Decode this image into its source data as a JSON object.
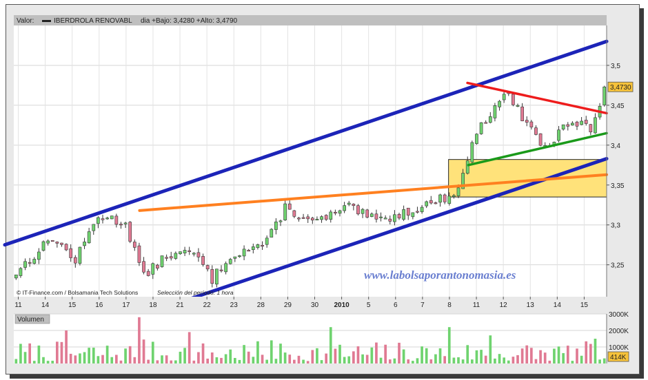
{
  "header": {
    "valor_label": "Valor:",
    "instrument": "IBERDROLA RENOVABL",
    "stats": "dia +Bajo: 3,4280 +Alto: 3,4790"
  },
  "credit": "© IT-Finance.com / Bolsamania Tech Solutions",
  "period": "Selección del período: 1 hora",
  "watermark": "www.labolsaporantonomasia.es",
  "last_price_label": "3,4730",
  "volume_label": "Volumen",
  "volume_last_label": "414K",
  "colors": {
    "up_candle": "#6fd36f",
    "down_candle": "#e07a93",
    "channel": "#1c24b8",
    "orange_line": "#ff8020",
    "red_line": "#ee1c1c",
    "green_line": "#1a9a1a",
    "zone_fill": "#ffe27a",
    "price_badge": "#f6c23a"
  },
  "chart_data": [
    {
      "type": "candlestick",
      "title": "IBERDROLA RENOVABL",
      "y_ticks": [
        "3,25",
        "3,3",
        "3,35",
        "3,4",
        "3,45",
        "3,5"
      ],
      "y_tick_values": [
        3.25,
        3.3,
        3.35,
        3.4,
        3.45,
        3.5
      ],
      "ylim": [
        3.21,
        3.55
      ],
      "x_tick_labels": [
        "11",
        "14",
        "15",
        "16",
        "17",
        "18",
        "21",
        "22",
        "23",
        "28",
        "29",
        "30",
        "2010",
        "5",
        "6",
        "7",
        "8",
        "11",
        "12",
        "13",
        "14",
        "15"
      ],
      "x_tick_positions": [
        0.5,
        3.5,
        6.5,
        9.5,
        12.5,
        15.5,
        18.5,
        21.5,
        24.5,
        27.5,
        30.5,
        33.5,
        36.5,
        39.5,
        42.5,
        45.5,
        48.5,
        51.5,
        54.5,
        57.5,
        60.5,
        63.5
      ],
      "x_domain": [
        0,
        66
      ],
      "n_bars": 130,
      "price_anchors": [
        [
          0,
          3.235
        ],
        [
          6,
          3.268
        ],
        [
          9,
          3.285
        ],
        [
          14,
          3.255
        ],
        [
          19,
          3.312
        ],
        [
          25,
          3.302
        ],
        [
          29,
          3.235
        ],
        [
          34,
          3.262
        ],
        [
          40,
          3.265
        ],
        [
          44,
          3.232
        ],
        [
          48,
          3.262
        ],
        [
          56,
          3.278
        ],
        [
          60,
          3.322
        ],
        [
          66,
          3.302
        ],
        [
          74,
          3.322
        ],
        [
          80,
          3.305
        ],
        [
          86,
          3.315
        ],
        [
          94,
          3.332
        ],
        [
          98,
          3.343
        ],
        [
          101,
          3.405
        ],
        [
          104,
          3.432
        ],
        [
          108,
          3.468
        ],
        [
          110,
          3.452
        ],
        [
          114,
          3.42
        ],
        [
          117,
          3.395
        ],
        [
          121,
          3.42
        ],
        [
          124,
          3.428
        ],
        [
          127,
          3.42
        ],
        [
          129,
          3.45
        ],
        [
          130,
          3.473
        ]
      ],
      "last_price": 3.473,
      "lines": [
        {
          "name": "channel-upper",
          "color": "#1c24b8",
          "from": [
            -1,
            3.275
          ],
          "to": [
            66,
            3.53
          ]
        },
        {
          "name": "channel-lower",
          "color": "#1c24b8",
          "from": [
            19.8,
            3.208
          ],
          "to": [
            66,
            3.383
          ]
        },
        {
          "name": "orange-trend",
          "color": "#ff8020",
          "from": [
            14,
            3.318
          ],
          "to": [
            66,
            3.363
          ]
        },
        {
          "name": "red-trend",
          "color": "#ee1c1c",
          "from": [
            50.5,
            3.478
          ],
          "to": [
            66,
            3.44
          ]
        },
        {
          "name": "green-trend",
          "color": "#1a9a1a",
          "from": [
            50.6,
            3.375
          ],
          "to": [
            66,
            3.415
          ]
        }
      ],
      "zone": {
        "x": [
          48.4,
          66
        ],
        "y": [
          3.335,
          3.382
        ]
      }
    },
    {
      "type": "bar",
      "title": "Volumen",
      "y_ticks": [
        "1000K",
        "2000K",
        "3000K"
      ],
      "y_tick_values": [
        1000,
        2000,
        3000
      ],
      "ylim": [
        0,
        3000
      ],
      "last_value_label": "414K",
      "n_bars": 130,
      "volume_seed": 7,
      "volume_spikes": [
        [
          11,
          2000
        ],
        [
          27,
          2800
        ],
        [
          28,
          1450
        ],
        [
          38,
          1900
        ],
        [
          56,
          1400
        ],
        [
          69,
          2200
        ],
        [
          95,
          2200
        ],
        [
          104,
          1700
        ],
        [
          127,
          1500
        ]
      ]
    }
  ]
}
